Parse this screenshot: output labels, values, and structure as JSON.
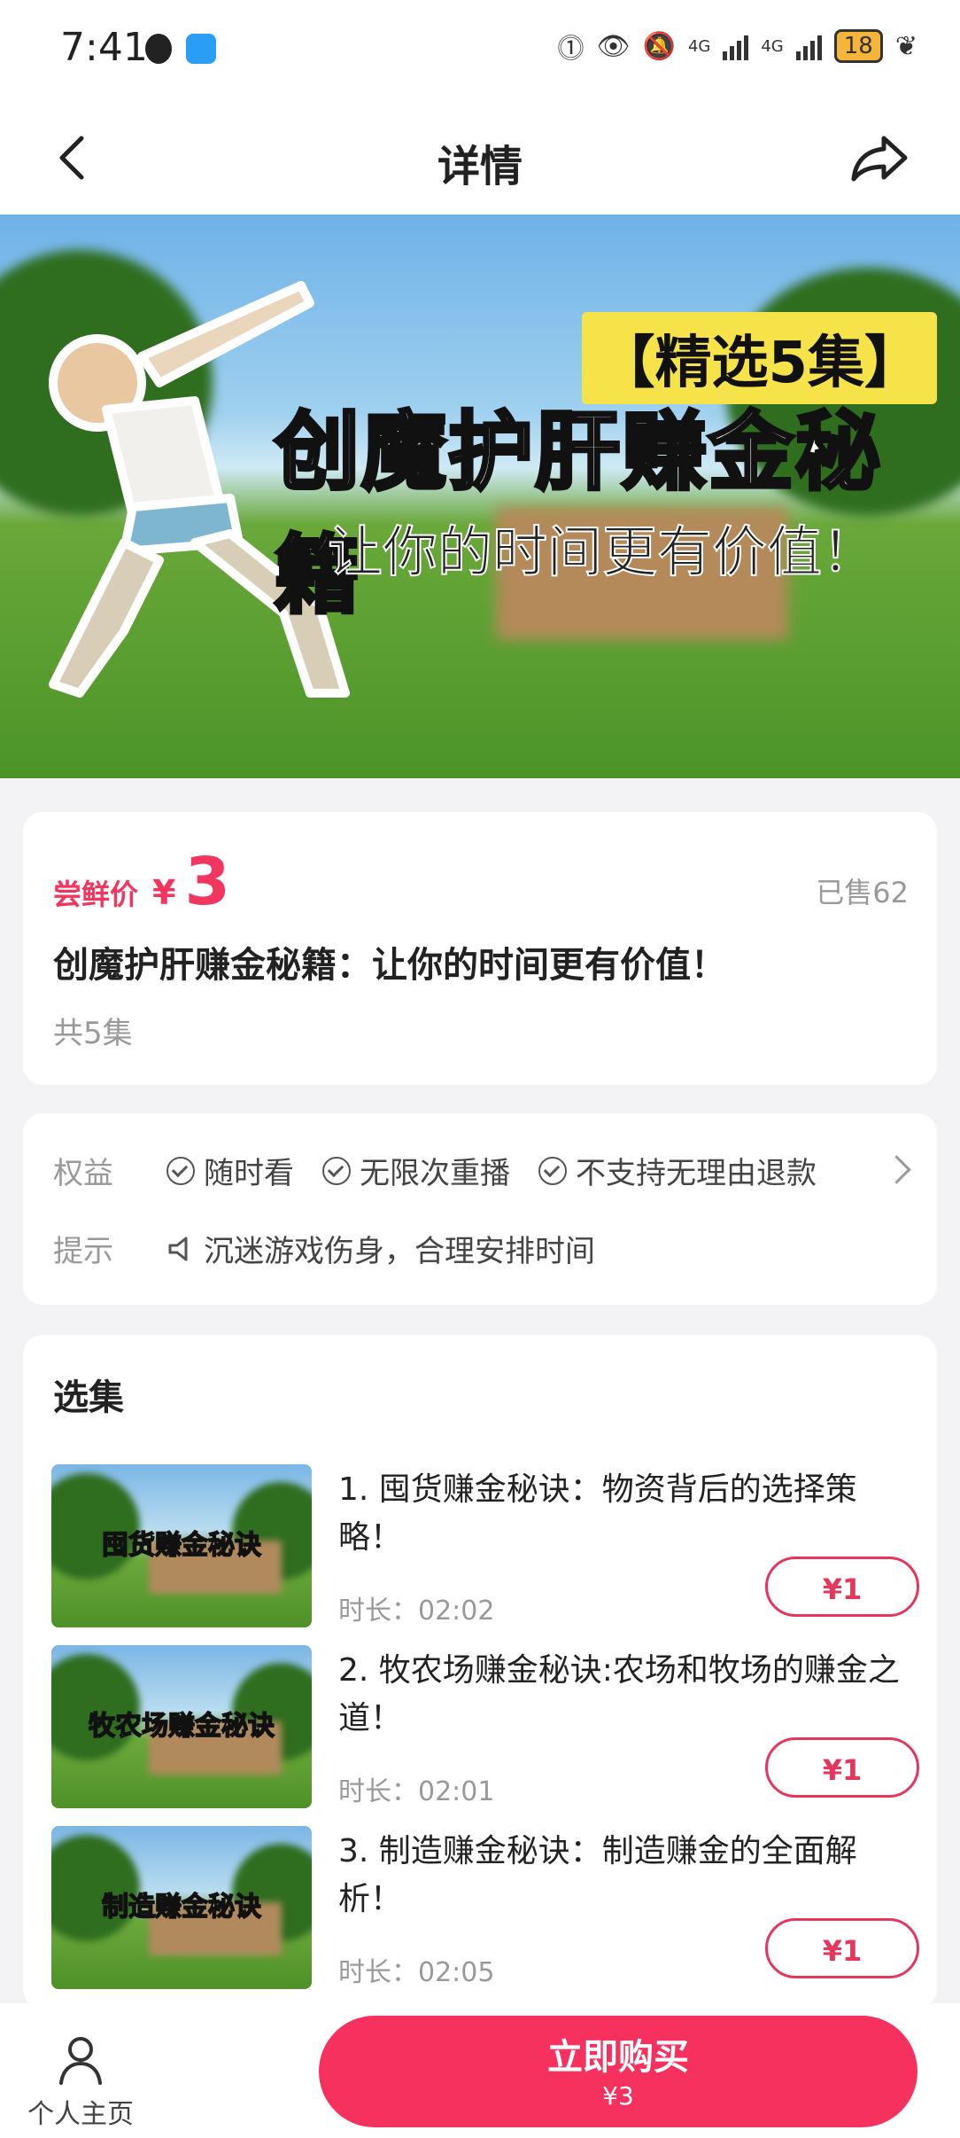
{
  "status_bar": {
    "time": "7:41",
    "network1": "4G",
    "network2": "4G",
    "battery": "18"
  },
  "nav": {
    "title": "详情"
  },
  "banner": {
    "tag": "【精选5集】",
    "title": "创魔护肝赚金秘籍",
    "subtitle": "让你的时间更有价值！"
  },
  "product": {
    "price_label": "尝鲜价",
    "currency": "¥",
    "price": "3",
    "sold": "已售62",
    "title": "创魔护肝赚金秘籍：让你的时间更有价值！",
    "episodes": "共5集"
  },
  "benefits": {
    "label": "权益",
    "items": [
      "随时看",
      "无限次重播",
      "不支持无理由退款"
    ],
    "tip_label": "提示",
    "tip": "沉迷游戏伤身，合理安排时间"
  },
  "episode_section": {
    "title": "选集",
    "items": [
      {
        "thumb_caption": "囤货赚金秘诀",
        "title": "1. 囤货赚金秘诀：物资背后的选择策略！",
        "duration": "时长：02:02",
        "price": "¥1"
      },
      {
        "thumb_caption": "牧农场赚金秘诀",
        "title": "2. 牧农场赚金秘诀:农场和牧场的赚金之道！",
        "duration": "时长：02:01",
        "price": "¥1"
      },
      {
        "thumb_caption": "制造赚金秘诀",
        "title": "3. 制造赚金秘诀：制造赚金的全面解析！",
        "duration": "时长：02:05",
        "price": "¥1"
      }
    ]
  },
  "bottom": {
    "home_label": "个人主页",
    "buy_label": "立即购买",
    "buy_price": "¥3"
  },
  "colors": {
    "accent": "#f7315e",
    "price": "#f2365f"
  }
}
